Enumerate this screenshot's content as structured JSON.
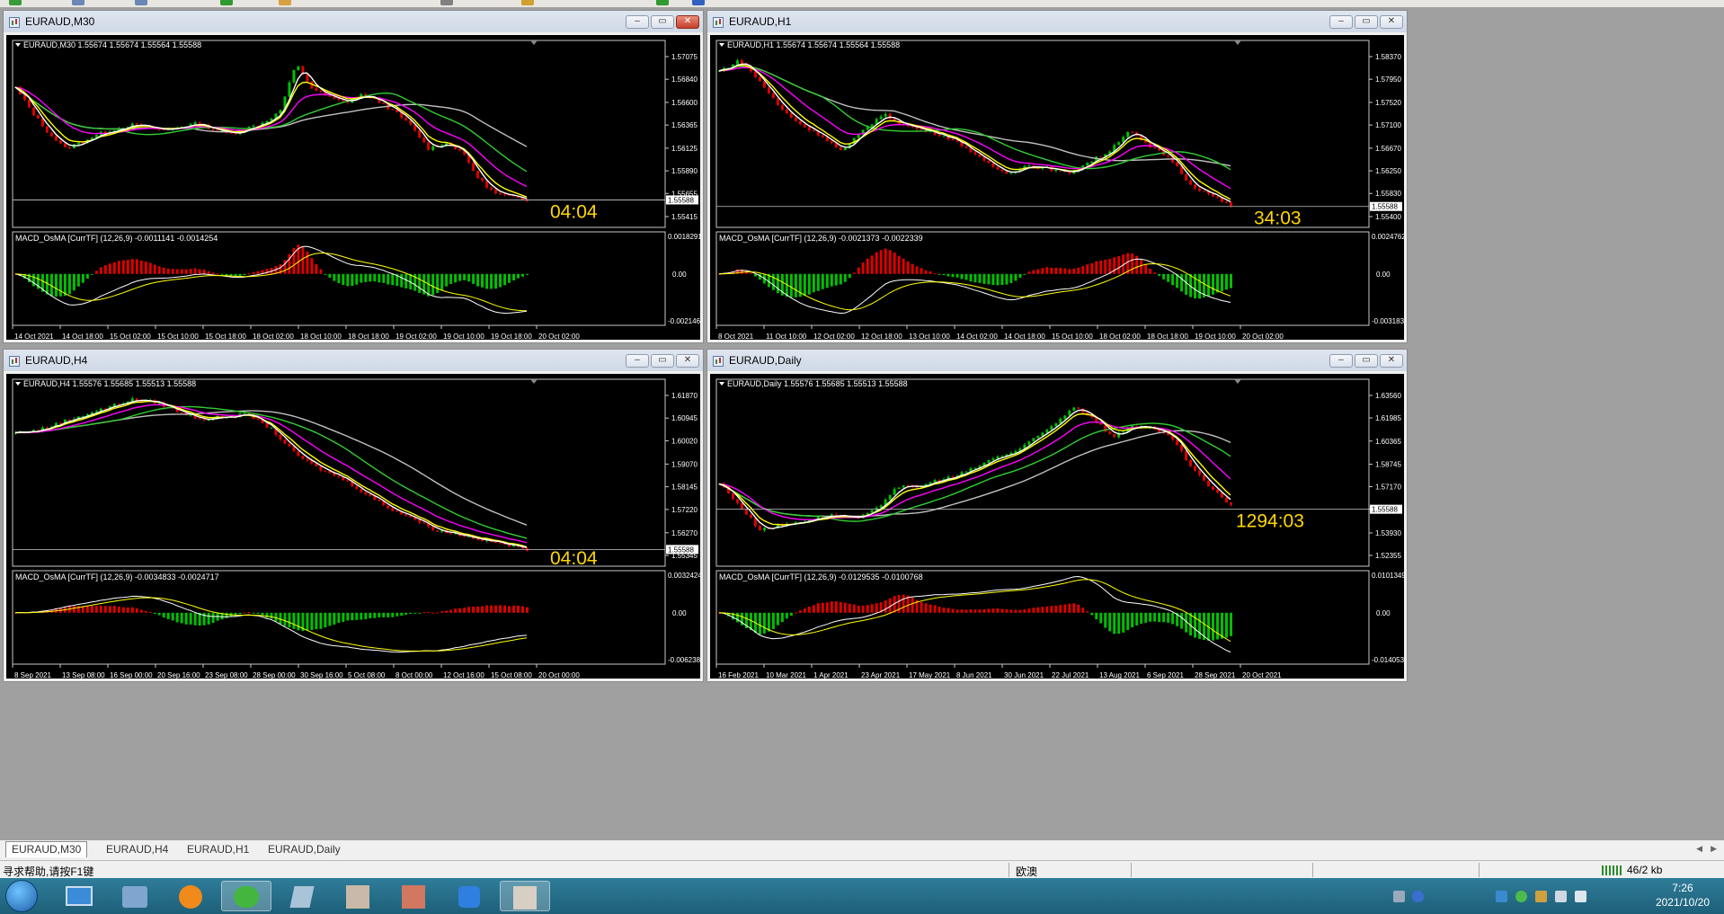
{
  "windows": [
    {
      "id": "m30",
      "title": "EURAUD,M30",
      "active": true,
      "info": "EURAUD,M30  1.55674 1.55674 1.55564 1.55588",
      "price_ticks": [
        "1.57075",
        "1.56840",
        "1.56600",
        "1.56365",
        "1.56125",
        "1.55890",
        "1.55655",
        "1.55415"
      ],
      "current_price": "1.55588",
      "timer": "04:04",
      "macd_label": "MACD_OsMA [CurrTF] (12,26,9) -0.0011141 -0.0014254",
      "macd_ticks": [
        "0.0018291",
        "0.00",
        "-0.002146"
      ],
      "time_ticks": [
        "14 Oct 2021",
        "14 Oct 18:00",
        "15 Oct 02:00",
        "15 Oct 10:00",
        "15 Oct 18:00",
        "18 Oct 02:00",
        "18 Oct 10:00",
        "18 Oct 18:00",
        "19 Oct 02:00",
        "19 Oct 10:00",
        "19 Oct 18:00",
        "20 Oct 02:00"
      ]
    },
    {
      "id": "h1",
      "title": "EURAUD,H1",
      "active": false,
      "info": "EURAUD,H1  1.55674 1.55674 1.55564 1.55588",
      "price_ticks": [
        "1.58370",
        "1.57950",
        "1.57520",
        "1.57100",
        "1.56670",
        "1.56250",
        "1.55830",
        "1.55400"
      ],
      "current_price": "1.55588",
      "timer": "34:03",
      "macd_label": "MACD_OsMA [CurrTF] (12,26,9) -0.0021373 -0.0022339",
      "macd_ticks": [
        "0.0024762",
        "0.00",
        "-0.003183"
      ],
      "time_ticks": [
        "8 Oct 2021",
        "11 Oct 10:00",
        "12 Oct 02:00",
        "12 Oct 18:00",
        "13 Oct 10:00",
        "14 Oct 02:00",
        "14 Oct 18:00",
        "15 Oct 10:00",
        "18 Oct 02:00",
        "18 Oct 18:00",
        "19 Oct 10:00",
        "20 Oct 02:00"
      ]
    },
    {
      "id": "h4",
      "title": "EURAUD,H4",
      "active": false,
      "info": "EURAUD,H4  1.55576 1.55685 1.55513 1.55588",
      "price_ticks": [
        "1.61870",
        "1.60945",
        "1.60020",
        "1.59070",
        "1.58145",
        "1.57220",
        "1.56270",
        "1.55345"
      ],
      "current_price": "1.55588",
      "timer": "04:04",
      "macd_label": "MACD_OsMA [CurrTF] (12,26,9) -0.0034833 -0.0024717",
      "macd_ticks": [
        "0.0032424",
        "0.00",
        "-0.006238"
      ],
      "time_ticks": [
        "8 Sep 2021",
        "13 Sep 08:00",
        "16 Sep 00:00",
        "20 Sep 16:00",
        "23 Sep 08:00",
        "28 Sep 00:00",
        "30 Sep 16:00",
        "5 Oct 08:00",
        "8 Oct 00:00",
        "12 Oct 16:00",
        "15 Oct 08:00",
        "20 Oct 00:00"
      ]
    },
    {
      "id": "daily",
      "title": "EURAUD,Daily",
      "active": false,
      "info": "EURAUD,Daily  1.55576 1.55685 1.55513 1.55588",
      "price_ticks": [
        "1.63560",
        "1.61985",
        "1.60365",
        "1.58745",
        "1.57170",
        "1.55588",
        "1.53930",
        "1.52355"
      ],
      "current_price": "1.55588",
      "timer": "1294:03",
      "macd_label": "MACD_OsMA [CurrTF] (12,26,9) -0.0129535 -0.0100768",
      "macd_ticks": [
        "0.0101349",
        "0.00",
        "-0.014053"
      ],
      "time_ticks": [
        "16 Feb 2021",
        "10 Mar 2021",
        "1 Apr 2021",
        "23 Apr 2021",
        "17 May 2021",
        "8 Jun 2021",
        "30 Jun 2021",
        "22 Jul 2021",
        "13 Aug 2021",
        "6 Sep 2021",
        "28 Sep 2021",
        "20 Oct 2021"
      ]
    }
  ],
  "tabs": [
    "EURAUD,M30",
    "EURAUD,H4",
    "EURAUD,H1",
    "EURAUD,Daily"
  ],
  "status": {
    "help": "寻求帮助,请按F1键",
    "profile": "欧澳",
    "traffic": "46/2 kb"
  },
  "taskbar": {
    "time": "7:26",
    "date": "2021/10/20"
  },
  "colors": {
    "bull": "#00c000",
    "bear": "#e00000",
    "ma_fast": "#ffff00",
    "ma_white": "#ffffff",
    "ma_magenta": "#ff00ff",
    "ma_green": "#32cd32",
    "ma_gray": "#c0c0c0",
    "timer": "#ffd700"
  },
  "chart_data": [
    {
      "type": "candlestick",
      "title": "EURAUD,M30",
      "ylim": [
        1.55415,
        1.57075
      ],
      "close_path": [
        1.5675,
        1.565,
        1.5628,
        1.5612,
        1.5619,
        1.5627,
        1.5632,
        1.5637,
        1.5634,
        1.5631,
        1.5635,
        1.5638,
        1.5632,
        1.5627,
        1.5633,
        1.5639,
        1.565,
        1.57,
        1.5674,
        1.5665,
        1.566,
        1.5668,
        1.5661,
        1.565,
        1.5635,
        1.5612,
        1.5618,
        1.561,
        1.5582,
        1.5566,
        1.5562,
        1.5559
      ]
    },
    {
      "type": "candlestick",
      "title": "EURAUD,H1",
      "ylim": [
        1.554,
        1.5837
      ],
      "close_path": [
        1.581,
        1.583,
        1.579,
        1.574,
        1.571,
        1.569,
        1.566,
        1.57,
        1.573,
        1.571,
        1.57,
        1.569,
        1.567,
        1.564,
        1.562,
        1.5635,
        1.563,
        1.562,
        1.564,
        1.566,
        1.57,
        1.567,
        1.565,
        1.56,
        1.558,
        1.556
      ]
    },
    {
      "type": "candlestick",
      "title": "EURAUD,H4",
      "ylim": [
        1.55345,
        1.6187
      ],
      "close_path": [
        1.6035,
        1.6045,
        1.608,
        1.611,
        1.614,
        1.617,
        1.616,
        1.612,
        1.609,
        1.61,
        1.611,
        1.605,
        1.595,
        1.589,
        1.585,
        1.579,
        1.573,
        1.569,
        1.564,
        1.562,
        1.56,
        1.558,
        1.556
      ]
    },
    {
      "type": "candlestick",
      "title": "EURAUD,Daily",
      "ylim": [
        1.52355,
        1.6356
      ],
      "close_path": [
        1.574,
        1.559,
        1.542,
        1.544,
        1.547,
        1.55,
        1.552,
        1.549,
        1.556,
        1.572,
        1.571,
        1.576,
        1.579,
        1.585,
        1.592,
        1.596,
        1.605,
        1.615,
        1.628,
        1.62,
        1.606,
        1.615,
        1.612,
        1.606,
        1.585,
        1.57,
        1.559
      ]
    }
  ]
}
